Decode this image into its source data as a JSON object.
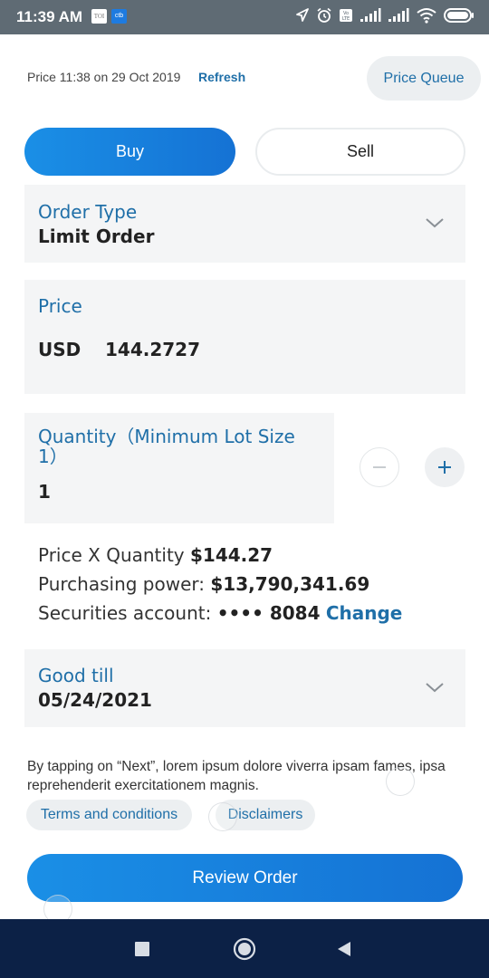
{
  "status_bar": {
    "time": "11:39 AM",
    "app_badges": [
      "TOI",
      "ctb"
    ],
    "icons": [
      "location-icon",
      "alarm-icon",
      "volte-icon",
      "signal-1-icon",
      "signal-2-icon",
      "wifi-icon",
      "battery-icon"
    ]
  },
  "header": {
    "price_time": "Price 11:38 on 29 Oct 2019",
    "refresh_label": "Refresh",
    "price_queue_label": "Price Queue"
  },
  "side_toggle": {
    "buy_label": "Buy",
    "sell_label": "Sell",
    "selected": "Buy"
  },
  "order_type": {
    "label": "Order Type",
    "value": "Limit Order"
  },
  "price": {
    "label": "Price",
    "currency": "USD",
    "value": "144.2727"
  },
  "quantity": {
    "label": "Quantity（Minimum Lot Size 1）",
    "value": "1"
  },
  "summary": {
    "price_x_qty_label": "Price X Quantity",
    "price_x_qty_value": "$144.27",
    "purchasing_power_label": "Purchasing power:",
    "purchasing_power_value": "$13,790,341.69",
    "securities_account_label": "Securities account:",
    "securities_account_value": "•••• 8084",
    "change_label": "Change"
  },
  "good_till": {
    "label": "Good till",
    "value": "05/24/2021"
  },
  "disclaimer": {
    "text": "By tapping on “Next”, lorem ipsum dolore viverra ipsam fames, ipsa reprehenderit exercitationem magnis.",
    "terms_label": "Terms and conditions",
    "disclaimers_label": "Disclaimers"
  },
  "actions": {
    "review_label": "Review Order"
  },
  "colors": {
    "accent": "#1f6fa8",
    "primary_button": "#1a8fe6",
    "card_bg": "#f4f5f6",
    "status_bar": "#5f6b74",
    "nav_bar": "#0c2146"
  }
}
